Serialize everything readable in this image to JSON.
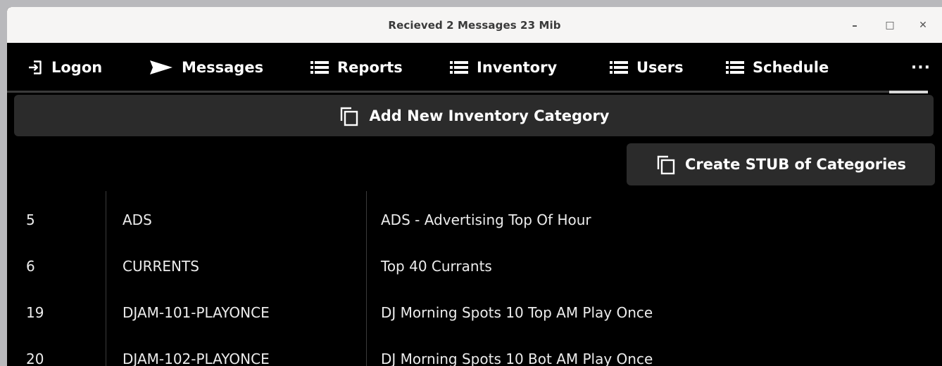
{
  "window": {
    "title": "Recieved 2 Messages  23 Mib",
    "controls": {
      "minimize": "–",
      "maximize": "□",
      "close": "✕"
    }
  },
  "nav": {
    "items": [
      {
        "label": "Logon",
        "icon": "login-icon"
      },
      {
        "label": "Messages",
        "icon": "send-icon"
      },
      {
        "label": "Reports",
        "icon": "list-icon"
      },
      {
        "label": "Inventory",
        "icon": "list-icon"
      },
      {
        "label": "Users",
        "icon": "list-icon"
      },
      {
        "label": "Schedule",
        "icon": "list-icon"
      }
    ],
    "more_label": "···"
  },
  "actions": {
    "add_category_label": "Add New Inventory Category",
    "create_stub_label": "Create STUB of Categories"
  },
  "table": {
    "rows": [
      {
        "id": "5",
        "code": "ADS",
        "description": "ADS - Advertising Top Of Hour"
      },
      {
        "id": "6",
        "code": "CURRENTS",
        "description": "Top 40 Currants"
      },
      {
        "id": "19",
        "code": "DJAM-101-PLAYONCE",
        "description": "DJ Morning Spots 10 Top AM Play Once"
      },
      {
        "id": "20",
        "code": "DJAM-102-PLAYONCE",
        "description": "DJ Morning Spots 10 Bot AM Play Once"
      }
    ]
  },
  "colors": {
    "background": "#000000",
    "titlebar": "#f6f5f4",
    "button": "#2b2b2b",
    "text": "#ffffff"
  }
}
